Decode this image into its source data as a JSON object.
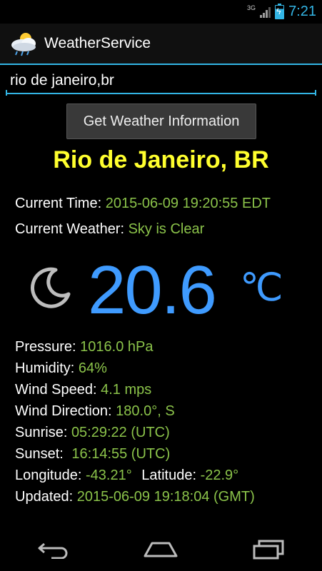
{
  "status": {
    "network": "3G",
    "time": "7:21"
  },
  "app": {
    "title": "WeatherService"
  },
  "search": {
    "value": "rio de janeiro,br"
  },
  "button": {
    "label": "Get Weather Information"
  },
  "weather": {
    "city": "Rio de Janeiro, BR",
    "current_time_label": "Current Time:",
    "current_time": "2015-06-09 19:20:55 EDT",
    "current_weather_label": "Current Weather:",
    "current_weather": "Sky is Clear",
    "temperature": "20.6",
    "temperature_unit": "℃",
    "pressure_label": "Pressure:",
    "pressure": "1016.0 hPa",
    "humidity_label": "Humidity:",
    "humidity": "64%",
    "wind_speed_label": "Wind Speed:",
    "wind_speed": "4.1 mps",
    "wind_direction_label": "Wind Direction:",
    "wind_direction": "180.0°, S",
    "sunrise_label": "Sunrise:",
    "sunrise": "05:29:22 (UTC)",
    "sunset_label": "Sunset:",
    "sunset": "16:14:55 (UTC)",
    "longitude_label": "Longitude:",
    "longitude": "-43.21°",
    "latitude_label": "Latitude:",
    "latitude": "-22.9°",
    "updated_label": "Updated:",
    "updated": "2015-06-09 19:18:04 (GMT)"
  },
  "icons": {
    "app": "weather-cloud-sun-icon",
    "condition": "moon-icon",
    "nav_back": "back-icon",
    "nav_home": "home-icon",
    "nav_recents": "recents-icon"
  },
  "colors": {
    "accent": "#33b5e5",
    "city": "#ffff2e",
    "value": "#8bc34a",
    "temperature": "#3f9bff"
  }
}
